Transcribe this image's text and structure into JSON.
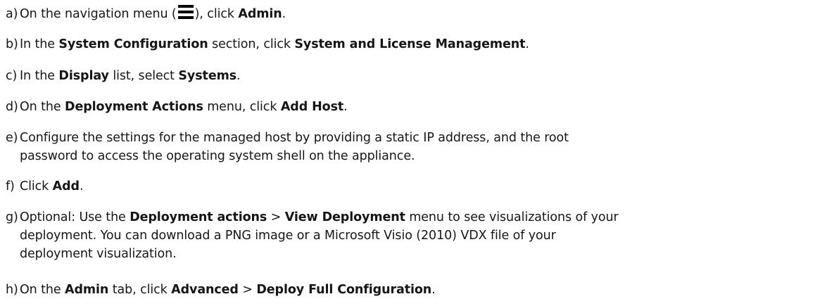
{
  "steps": [
    {
      "marker": "a)",
      "parts": [
        "On the navigation menu (",
        "), click ",
        "Admin",
        "."
      ],
      "icon": "hamburger-menu-icon"
    },
    {
      "marker": "b)",
      "parts": [
        "In the ",
        "System Configuration",
        " section, click ",
        "System and License Management",
        "."
      ]
    },
    {
      "marker": "c)",
      "parts": [
        "In the ",
        "Display",
        " list, select ",
        "Systems",
        "."
      ]
    },
    {
      "marker": "d)",
      "parts": [
        "On the ",
        "Deployment Actions",
        " menu, click ",
        "Add Host",
        "."
      ]
    },
    {
      "marker": "e)",
      "lines": [
        "Configure the settings for the managed host by providing a static IP address, and the root",
        "password to access the operating system shell on the appliance."
      ]
    },
    {
      "marker": "f)",
      "parts": [
        "Click ",
        "Add",
        "."
      ]
    },
    {
      "marker": "g)",
      "parts": [
        "Optional: Use the ",
        "Deployment actions",
        " > ",
        "View Deployment",
        " menu to see visualizations of your"
      ],
      "cont_lines": [
        "deployment. You can download a PNG image or a Microsoft Visio (2010) VDX file of your",
        "deployment visualization."
      ]
    },
    {
      "marker": "h)",
      "parts": [
        "On the ",
        "Admin",
        " tab, click ",
        "Advanced",
        " > ",
        "Deploy Full Configuration",
        "."
      ]
    }
  ]
}
